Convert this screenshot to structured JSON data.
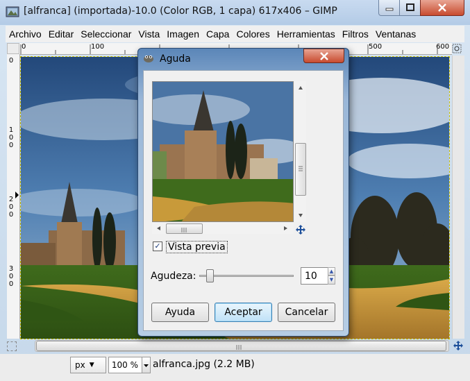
{
  "window": {
    "title": "[alfranca] (importada)-10.0 (Color RGB, 1 capa) 617x406 – GIMP"
  },
  "menubar": {
    "items": [
      "Archivo",
      "Editar",
      "Seleccionar",
      "Vista",
      "Imagen",
      "Capa",
      "Colores",
      "Herramientas",
      "Filtros",
      "Ventanas"
    ]
  },
  "rulers": {
    "horizontal": [
      "0",
      "100",
      "500",
      "600"
    ],
    "vertical": [
      "0",
      "1\n0\n0",
      "2\n0\n0",
      "3\n0\n0"
    ]
  },
  "statusbar": {
    "unit": "px",
    "zoom": "100 %",
    "file_info": "alfranca.jpg (2.2 MB)"
  },
  "dialog": {
    "title": "Aguda",
    "preview_label": "Vista previa",
    "preview_checked": true,
    "sharpness_label": "Agudeza:",
    "sharpness_value": "10",
    "slider_fraction": 0.1,
    "buttons": {
      "help": "Ayuda",
      "ok": "Aceptar",
      "cancel": "Cancelar"
    }
  },
  "colors": {
    "titlebar": "#b3cbe6",
    "close_red": "#c84b2f",
    "sky": "#3a6aa0",
    "grass": "#4a7a22",
    "path": "#c89a3a"
  }
}
